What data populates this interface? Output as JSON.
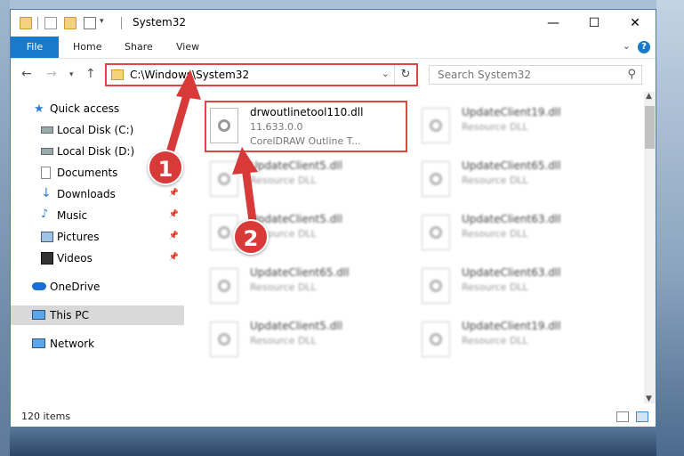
{
  "window": {
    "title": "System32",
    "controls": [
      "—",
      "☐",
      "✕"
    ]
  },
  "ribbon": {
    "tabs": [
      "File",
      "Home",
      "Share",
      "View"
    ]
  },
  "address_bar": {
    "path": "C:\\Windows\\System32"
  },
  "search": {
    "placeholder": "Search System32"
  },
  "nav_pane": {
    "items": [
      {
        "label": "Quick access",
        "icon": "star-icon",
        "pinned": false
      },
      {
        "label": "Local Disk (C:)",
        "icon": "drive-icon",
        "pinned": false
      },
      {
        "label": "Local Disk (D:)",
        "icon": "drive-icon",
        "pinned": false
      },
      {
        "label": "Documents",
        "icon": "documents-icon",
        "pinned": false
      },
      {
        "label": "Downloads",
        "icon": "download-icon",
        "pinned": true
      },
      {
        "label": "Music",
        "icon": "music-icon",
        "pinned": true
      },
      {
        "label": "Pictures",
        "icon": "pictures-icon",
        "pinned": true
      },
      {
        "label": "Videos",
        "icon": "videos-icon",
        "pinned": true
      },
      {
        "label": "OneDrive",
        "icon": "cloud-icon",
        "pinned": false
      },
      {
        "label": "This PC",
        "icon": "computer-icon",
        "pinned": false
      },
      {
        "label": "Network",
        "icon": "network-icon",
        "pinned": false
      }
    ]
  },
  "files": [
    {
      "name": "drwoutlinetool110.dll",
      "line1": "11.633.0.0",
      "line2": "CorelDRAW Outline T..."
    },
    {
      "name": "UpdateClient19.dll",
      "line1": "Resource DLL"
    },
    {
      "name": "UpdateClient5.dll",
      "line1": "Resource DLL"
    },
    {
      "name": "UpdateClient65.dll",
      "line1": "Resource DLL"
    },
    {
      "name": "UpdateClient5.dll",
      "line1": "Resource DLL"
    },
    {
      "name": "UpdateClient63.dll",
      "line1": "Resource DLL"
    },
    {
      "name": "UpdateClient65.dll",
      "line1": "Resource DLL"
    },
    {
      "name": "UpdateClient63.dll",
      "line1": "Resource DLL"
    },
    {
      "name": "UpdateClient5.dll",
      "line1": "Resource DLL"
    },
    {
      "name": "UpdateClient19.dll",
      "line1": "Resource DLL"
    }
  ],
  "status": {
    "item_count": "120 items"
  },
  "annotations": {
    "step1": "1",
    "step2": "2",
    "color": "#d83a3a"
  }
}
